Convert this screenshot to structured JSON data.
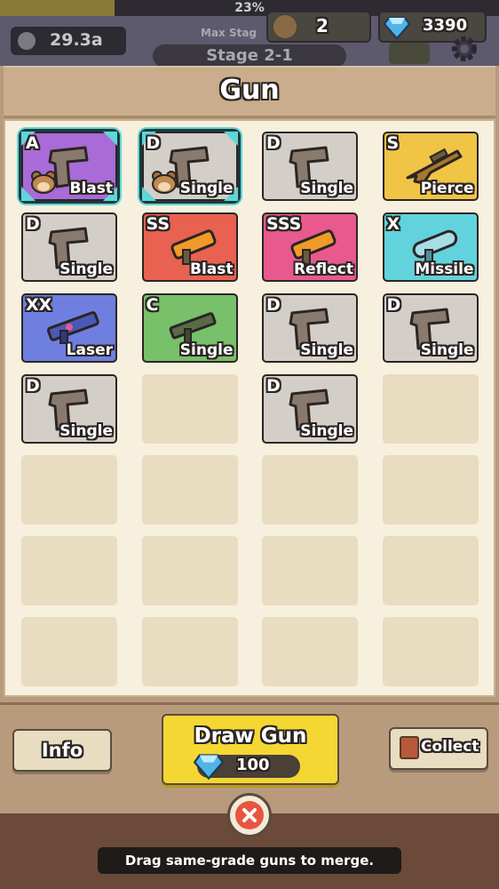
{
  "hud": {
    "progress_text": "23%",
    "progress_value": 0.23,
    "coins": "29.3a",
    "max_stage_label": "Max Stag",
    "stage": "Stage 2-1",
    "hamster_count": "2",
    "gems": "3390",
    "icons": [
      "coin-icon",
      "hamster-icon",
      "gem-icon",
      "battery-icon",
      "gear-icon"
    ]
  },
  "panel": {
    "title": "Gun"
  },
  "colors": {
    "A": "#a86bd8",
    "D": "#d3cfc8",
    "S": "#f0c445",
    "SS": "#e86151",
    "SSS": "#e85a8e",
    "X": "#62d3dc",
    "XX": "#6f7fe0",
    "C": "#78c06a",
    "empty": "#e8dcc1",
    "selected_border": "#5fd6d8"
  },
  "grid": [
    {
      "grade": "A",
      "type": "Blast",
      "gun": "pistol",
      "selected": true,
      "hamster": true
    },
    {
      "grade": "D",
      "type": "Single",
      "gun": "pistol",
      "selected": true,
      "hamster": true
    },
    {
      "grade": "D",
      "type": "Single",
      "gun": "pistol"
    },
    {
      "grade": "S",
      "type": "Pierce",
      "gun": "sniper"
    },
    {
      "grade": "D",
      "type": "Single",
      "gun": "pistol"
    },
    {
      "grade": "SS",
      "type": "Blast",
      "gun": "launcher"
    },
    {
      "grade": "SSS",
      "type": "Reflect",
      "gun": "launcher"
    },
    {
      "grade": "X",
      "type": "Missile",
      "gun": "missile"
    },
    {
      "grade": "XX",
      "type": "Laser",
      "gun": "laser"
    },
    {
      "grade": "C",
      "type": "Single",
      "gun": "smg"
    },
    {
      "grade": "D",
      "type": "Single",
      "gun": "pistol"
    },
    {
      "grade": "D",
      "type": "Single",
      "gun": "pistol"
    },
    {
      "grade": "D",
      "type": "Single",
      "gun": "pistol"
    },
    null,
    {
      "grade": "D",
      "type": "Single",
      "gun": "pistol"
    },
    null,
    null,
    null,
    null,
    null,
    null,
    null,
    null,
    null,
    null,
    null,
    null,
    null
  ],
  "buttons": {
    "info": "Info",
    "draw_gun": "Draw Gun",
    "draw_cost": "100",
    "collect": "Collect"
  },
  "hint": "Drag same-grade guns to merge."
}
